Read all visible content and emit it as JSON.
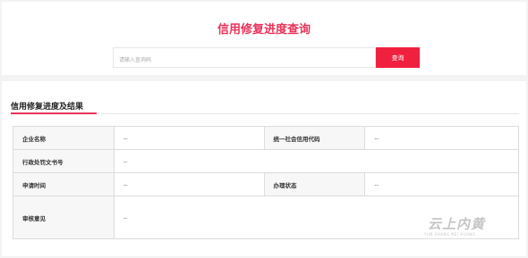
{
  "header": {
    "title": "信用修复进度查询",
    "search_placeholder": "请输入查询码",
    "search_button_label": "查询"
  },
  "result_section": {
    "title": "信用修复进度及结果",
    "rows": [
      {
        "label1": "企业名称",
        "value1": "--",
        "label2": "统一社会信用代码",
        "value2": "--"
      },
      {
        "label1": "行政处罚文书号",
        "value1": "--"
      },
      {
        "label1": "申请时间",
        "value1": "--",
        "label2": "办理状态",
        "value2": "--"
      },
      {
        "label1": "审核意见",
        "value1": "--"
      }
    ]
  },
  "watermark": {
    "text": "云上内黄",
    "subtext": "YUN SHANG NEI HUANG"
  },
  "colors": {
    "accent": "#e8335a",
    "button": "#f0213f"
  }
}
